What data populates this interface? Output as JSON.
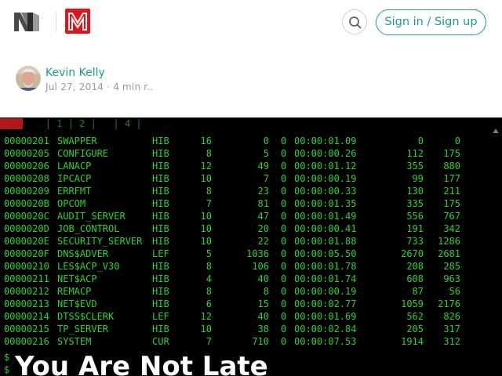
{
  "header": {
    "signin_label": "Sign in / Sign up"
  },
  "icons": {
    "medium_logo": "medium-logo-icon",
    "publication_logo": "publication-logo-icon",
    "search": "search-icon"
  },
  "colors": {
    "accent": "#1c9c8a",
    "publication_red": "#e0151c",
    "terminal_green": "#2fd12f",
    "terminal_bg": "#000000"
  },
  "author": {
    "name": "Kevin Kelly",
    "date": "Jul 27, 2014",
    "separator": "·",
    "read_time": "4 min r.."
  },
  "terminal": {
    "tabs_text": "    | 1 | 2 |   | 4 |",
    "rows": [
      {
        "pid": "00000201",
        "name": "SWAPPER",
        "state": "HIB",
        "pri": "16",
        "io": "0",
        "zero": "0",
        "time": "00:00:01.09",
        "pages": "0",
        "mem": "0"
      },
      {
        "pid": "00000205",
        "name": "CONFIGURE",
        "state": "HIB",
        "pri": "8",
        "io": "5",
        "zero": "0",
        "time": "00:00:00.26",
        "pages": "112",
        "mem": "175"
      },
      {
        "pid": "00000206",
        "name": "LANACP",
        "state": "HIB",
        "pri": "12",
        "io": "49",
        "zero": "0",
        "time": "00:00:01.12",
        "pages": "355",
        "mem": "880"
      },
      {
        "pid": "00000208",
        "name": "IPCACP",
        "state": "HIB",
        "pri": "10",
        "io": "7",
        "zero": "0",
        "time": "00:00:00.19",
        "pages": "99",
        "mem": "177"
      },
      {
        "pid": "00000209",
        "name": "ERRFMT",
        "state": "HIB",
        "pri": "8",
        "io": "23",
        "zero": "0",
        "time": "00:00:00.33",
        "pages": "130",
        "mem": "211"
      },
      {
        "pid": "0000020B",
        "name": "OPCOM",
        "state": "HIB",
        "pri": "7",
        "io": "81",
        "zero": "0",
        "time": "00:00:01.35",
        "pages": "335",
        "mem": "175"
      },
      {
        "pid": "0000020C",
        "name": "AUDIT_SERVER",
        "state": "HIB",
        "pri": "10",
        "io": "47",
        "zero": "0",
        "time": "00:00:01.49",
        "pages": "556",
        "mem": "767"
      },
      {
        "pid": "0000020D",
        "name": "JOB_CONTROL",
        "state": "HIB",
        "pri": "10",
        "io": "20",
        "zero": "0",
        "time": "00:00:00.41",
        "pages": "191",
        "mem": "342"
      },
      {
        "pid": "0000020E",
        "name": "SECURITY_SERVER",
        "state": "HIB",
        "pri": "10",
        "io": "22",
        "zero": "0",
        "time": "00:00:01.88",
        "pages": "733",
        "mem": "1286"
      },
      {
        "pid": "0000020F",
        "name": "DNS$ADVER",
        "state": "LEF",
        "pri": "5",
        "io": "1036",
        "zero": "0",
        "time": "00:00:05.50",
        "pages": "2670",
        "mem": "2681"
      },
      {
        "pid": "00000210",
        "name": "LES$ACP_V30",
        "state": "HIB",
        "pri": "8",
        "io": "106",
        "zero": "0",
        "time": "00:00:01.78",
        "pages": "208",
        "mem": "285"
      },
      {
        "pid": "00000211",
        "name": "NET$ACP",
        "state": "HIB",
        "pri": "4",
        "io": "40",
        "zero": "0",
        "time": "00:00:01.74",
        "pages": "608",
        "mem": "963"
      },
      {
        "pid": "00000212",
        "name": "REMACP",
        "state": "HIB",
        "pri": "8",
        "io": "8",
        "zero": "0",
        "time": "00:00:00.19",
        "pages": "87",
        "mem": "56"
      },
      {
        "pid": "00000213",
        "name": "NET$EVD",
        "state": "HIB",
        "pri": "6",
        "io": "15",
        "zero": "0",
        "time": "00:00:02.77",
        "pages": "1059",
        "mem": "2176"
      },
      {
        "pid": "00000214",
        "name": "DTSS$CLERK",
        "state": "LEF",
        "pri": "12",
        "io": "40",
        "zero": "0",
        "time": "00:00:01.69",
        "pages": "562",
        "mem": "826"
      },
      {
        "pid": "00000215",
        "name": "TP_SERVER",
        "state": "HIB",
        "pri": "10",
        "io": "38",
        "zero": "0",
        "time": "00:00:02.84",
        "pages": "205",
        "mem": "317"
      },
      {
        "pid": "00000216",
        "name": "SYSTEM",
        "state": "CUR",
        "pri": "7",
        "io": "710",
        "zero": "0",
        "time": "00:00:07.53",
        "pages": "1914",
        "mem": "312"
      }
    ],
    "prompt_1": "$",
    "prompt_2": "$"
  },
  "article": {
    "title": "You Are Not Late"
  }
}
